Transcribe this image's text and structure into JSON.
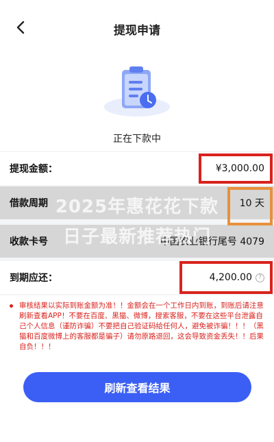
{
  "header": {
    "title": "提现申请",
    "back_icon": "chevron-left-icon"
  },
  "hero": {
    "status": "正在下款中",
    "icon": "clipboard-clock-icon"
  },
  "rows": {
    "amount": {
      "label": "提现金额：",
      "value": "¥3,000.00"
    },
    "period": {
      "label": "借款周期",
      "value": "10 天"
    },
    "account": {
      "label": "收款卡号",
      "value": "中国农业银行尾号 4079"
    },
    "due": {
      "label": "到期应还：",
      "value": "4,200.00"
    }
  },
  "watermark": {
    "line1": "2025年惠花花下款",
    "line2": "日子最新推荐热门"
  },
  "notice": {
    "text": "审核结果以实际到账金额为准！！金额会在一个工作日内到账，到账后请注意刷新查看APP！不要在百度、黑猫、微博，搜索客服，不要在这些平台泄露自己个人信息（谨防诈骗）不要把自己验证码给任何人，避免被诈骗！！！（黑猫和百度微博上的客服都是骗子）请勿原路退回，这会导致资金丢失！！后果自负！！！"
  },
  "button": {
    "label": "刷新查看结果"
  },
  "colors": {
    "accent": "#3b5ff5",
    "warning": "#d9221c",
    "highlight_orange": "#e8903a"
  }
}
